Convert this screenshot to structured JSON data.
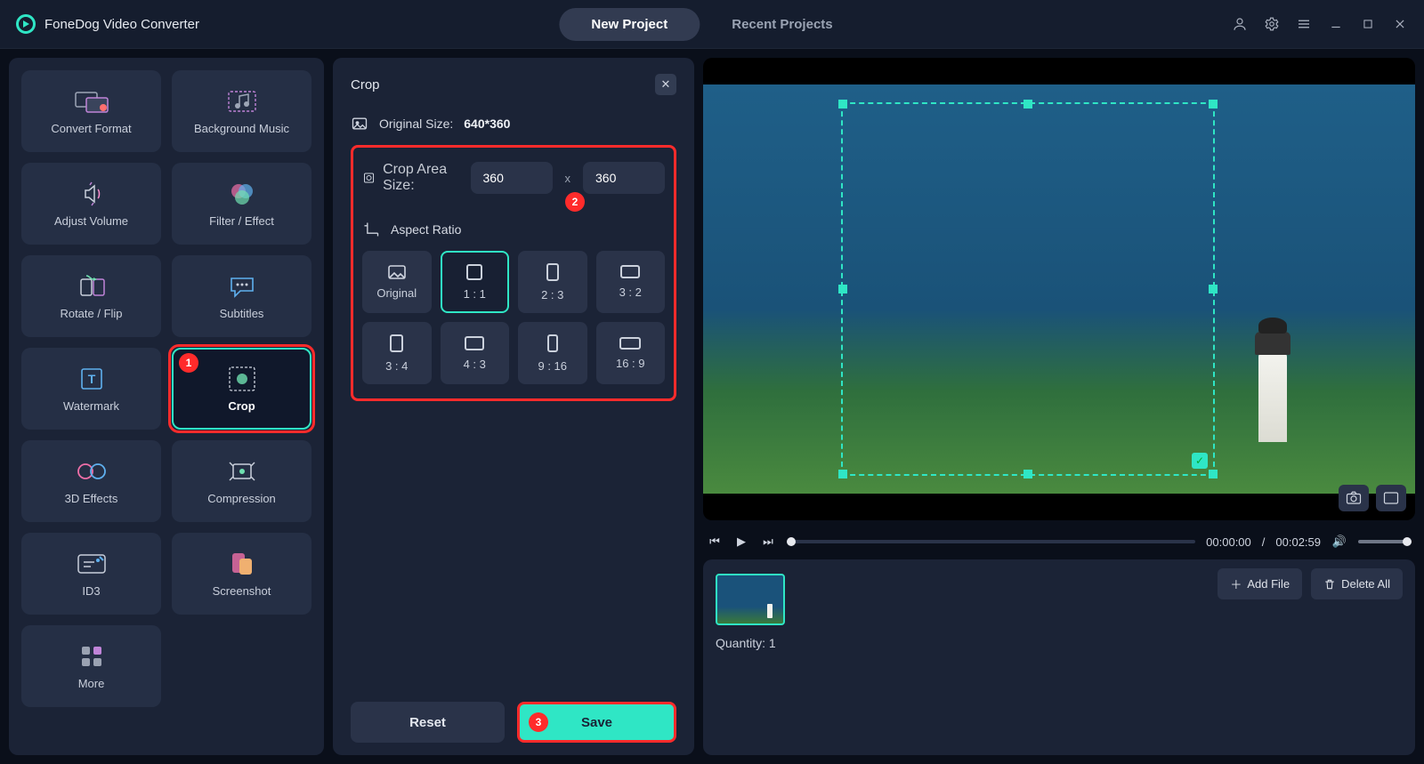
{
  "app": {
    "title": "FoneDog Video Converter"
  },
  "tabs": {
    "new_project": "New Project",
    "recent_projects": "Recent Projects"
  },
  "sidebar": {
    "tools": [
      {
        "id": "convert-format",
        "label": "Convert Format"
      },
      {
        "id": "background-music",
        "label": "Background Music"
      },
      {
        "id": "adjust-volume",
        "label": "Adjust Volume"
      },
      {
        "id": "filter-effect",
        "label": "Filter / Effect"
      },
      {
        "id": "rotate-flip",
        "label": "Rotate / Flip"
      },
      {
        "id": "subtitles",
        "label": "Subtitles"
      },
      {
        "id": "watermark",
        "label": "Watermark"
      },
      {
        "id": "crop",
        "label": "Crop"
      },
      {
        "id": "3d-effects",
        "label": "3D Effects"
      },
      {
        "id": "compression",
        "label": "Compression"
      },
      {
        "id": "id3",
        "label": "ID3"
      },
      {
        "id": "screenshot",
        "label": "Screenshot"
      },
      {
        "id": "more",
        "label": "More"
      }
    ]
  },
  "crop": {
    "title": "Crop",
    "original_size_label": "Original Size:",
    "original_size_value": "640*360",
    "crop_area_label": "Crop Area Size:",
    "width": "360",
    "height": "360",
    "x_sep": "x",
    "aspect_label": "Aspect Ratio",
    "ratios": [
      "Original",
      "1 : 1",
      "2 : 3",
      "3 : 2",
      "3 : 4",
      "4 : 3",
      "9 : 16",
      "16 : 9"
    ],
    "reset": "Reset",
    "save": "Save"
  },
  "callouts": {
    "one": "1",
    "two": "2",
    "three": "3"
  },
  "player": {
    "current": "00:00:00",
    "sep": " / ",
    "total": "00:02:59"
  },
  "footer": {
    "add_file": "Add File",
    "delete_all": "Delete All",
    "quantity_label": "Quantity:",
    "quantity_value": "1"
  },
  "colors": {
    "accent": "#2fe6c5",
    "danger": "#ff2b2b"
  }
}
